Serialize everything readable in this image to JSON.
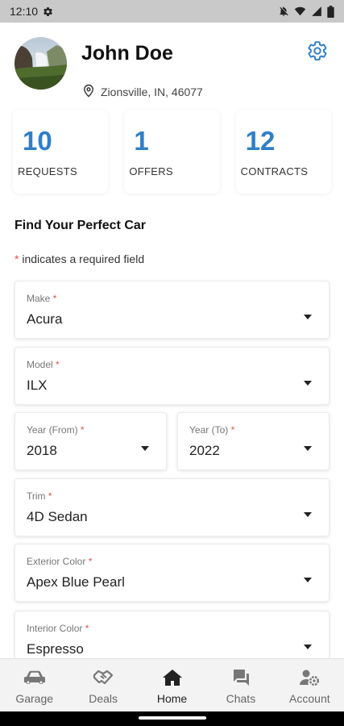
{
  "status_bar": {
    "time": "12:10"
  },
  "profile": {
    "name": "John Doe",
    "location": "Zionsville, IN, 46077"
  },
  "stats": [
    {
      "value": "10",
      "label": "REQUESTS"
    },
    {
      "value": "1",
      "label": "OFFERS"
    },
    {
      "value": "12",
      "label": "CONTRACTS"
    }
  ],
  "form": {
    "title": "Find Your Perfect Car",
    "required_mark": "*",
    "required_note": " indicates a required field",
    "make": {
      "label": "Make",
      "value": "Acura"
    },
    "model": {
      "label": "Model",
      "value": "ILX"
    },
    "year_from": {
      "label": "Year (From)",
      "value": "2018"
    },
    "year_to": {
      "label": "Year (To)",
      "value": "2022"
    },
    "trim": {
      "label": "Trim",
      "value": "4D Sedan"
    },
    "exterior_color": {
      "label": "Exterior Color",
      "value": "Apex Blue Pearl"
    },
    "interior_color": {
      "label": "Interior Color",
      "value": "Espresso"
    }
  },
  "nav": {
    "garage": "Garage",
    "deals": "Deals",
    "home": "Home",
    "chats": "Chats",
    "account": "Account"
  },
  "colors": {
    "accent": "#2f7fc8",
    "required": "#e2524a"
  }
}
